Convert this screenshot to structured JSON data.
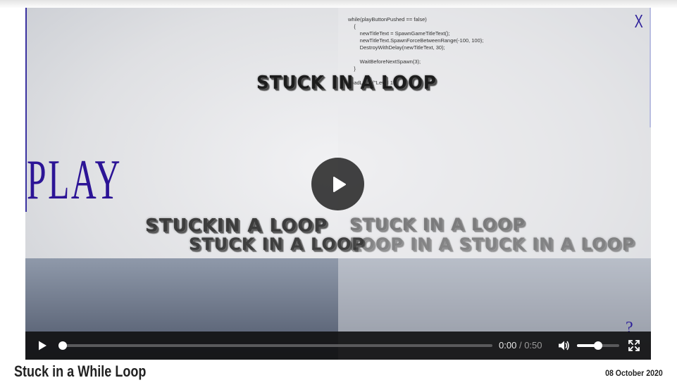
{
  "video": {
    "code_lines": [
      "while(playButtonPushed == false)",
      "    {",
      "        newTitleText = SpawnGameTitleText();",
      "        newTitleText.SpawnForceBetweenRange(-100, 100);",
      "        DestroyWithDelay(newTitleText, 30);",
      "",
      "        WaitBeforeNextSpawn(3);",
      "    }",
      "",
      "LoadLevel(\"Level 1\");"
    ],
    "close_label": "X",
    "play_word": "PLAY",
    "floating_title": "STUCK IN A LOOP",
    "jumbled_row_1": "STUCKIN A LOOP",
    "jumbled_row_2": "STUCK IN A LOOP",
    "jumbled_row_3": "STUCK IN A LOOP",
    "jumbled_row_4": "LOOP IN A STUCK IN A LOOP",
    "question_mark": "?"
  },
  "controls": {
    "current_time": "0:00",
    "separator": "/",
    "duration": "0:50",
    "progress_fraction": 0,
    "volume_fraction": 0.5
  },
  "caption": {
    "title": "Stuck in a While Loop",
    "date": "08 October 2020"
  },
  "colors": {
    "accent_purple": "#2c1496",
    "control_bar": "#121214",
    "play_button_bg": "#282828"
  },
  "icons": {
    "big_play": "play-icon",
    "control_play": "play-icon",
    "volume": "volume-icon",
    "fullscreen": "fullscreen-icon"
  }
}
